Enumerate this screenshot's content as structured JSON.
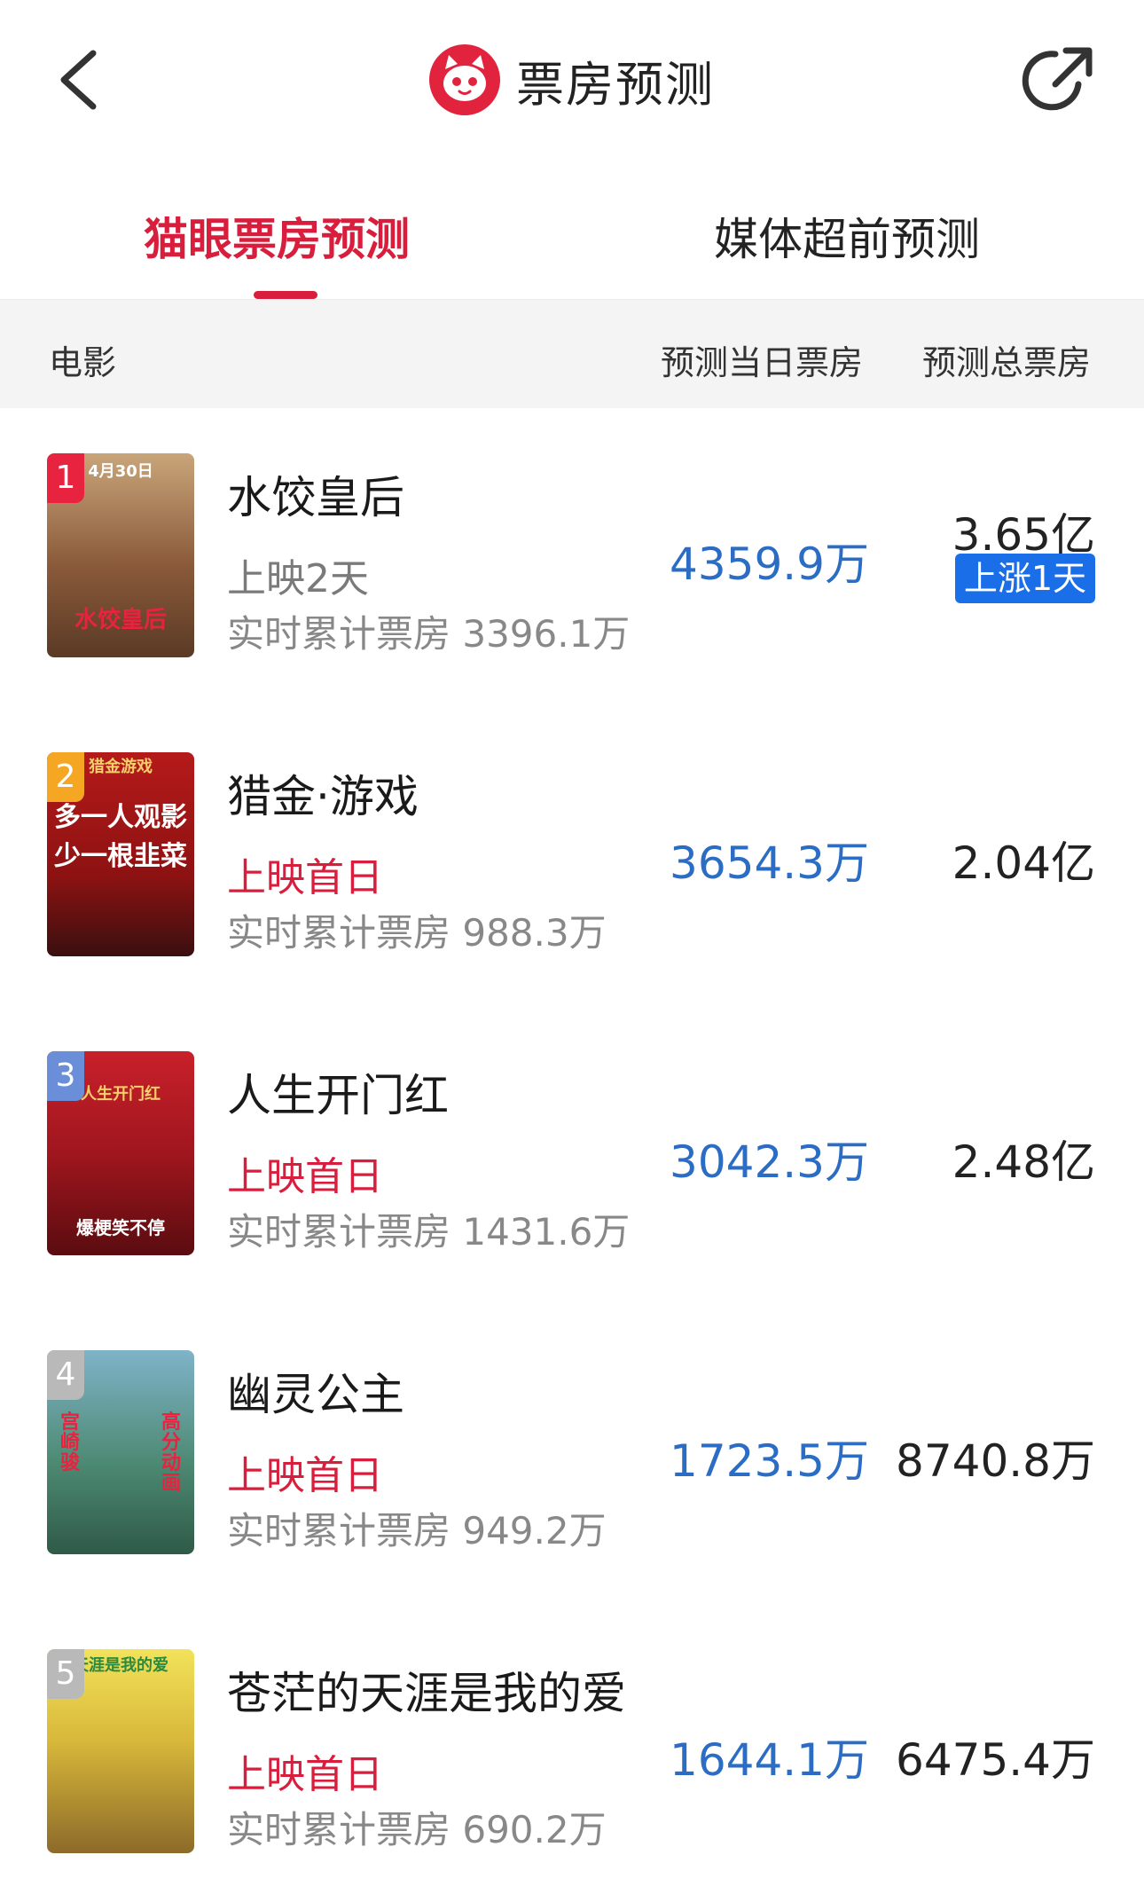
{
  "topbar": {
    "title": "票房预测",
    "back_icon": "chevron-left-icon",
    "share_icon": "share-icon",
    "logo_icon": "maoyan-cat-logo"
  },
  "tabs": [
    {
      "label": "猫眼票房预测",
      "active": true
    },
    {
      "label": "媒体超前预测",
      "active": false
    }
  ],
  "table": {
    "headers": {
      "movie": "电影",
      "day_forecast": "预测当日票房",
      "total_forecast": "预测总票房"
    },
    "rows": [
      {
        "rank": "1",
        "title": "水饺皇后",
        "status": "上映2天",
        "cumulative": "实时累计票房 3396.1万",
        "day_forecast": "4359.9万",
        "total_forecast": "3.65亿",
        "trend": "上涨1天",
        "poster_lines": [
          "4月30日",
          "水饺皇后"
        ]
      },
      {
        "rank": "2",
        "title": "猎金·游戏",
        "status": "上映首日",
        "cumulative": "实时累计票房 988.3万",
        "day_forecast": "3654.3万",
        "total_forecast": "2.04亿",
        "poster_lines": [
          "猎金游戏",
          "多一人观影",
          "少一根韭菜"
        ]
      },
      {
        "rank": "3",
        "title": "人生开门红",
        "status": "上映首日",
        "cumulative": "实时累计票房 1431.6万",
        "day_forecast": "3042.3万",
        "total_forecast": "2.48亿",
        "poster_lines": [
          "人生开门红",
          "爆梗笑不停"
        ]
      },
      {
        "rank": "4",
        "title": "幽灵公主",
        "status": "上映首日",
        "cumulative": "实时累计票房 949.2万",
        "day_forecast": "1723.5万",
        "total_forecast": "8740.8万",
        "poster_lines": [
          "宫崎骏",
          "高分动画"
        ]
      },
      {
        "rank": "5",
        "title": "苍茫的天涯是我的爱",
        "status": "上映首日",
        "cumulative": "实时累计票房 690.2万",
        "day_forecast": "1644.1万",
        "total_forecast": "6475.4万",
        "poster_lines": [
          "天涯是我的爱"
        ]
      }
    ]
  },
  "colors": {
    "brand_red": "#d81e3c",
    "forecast_blue": "#2b6cc4",
    "trend_badge_blue": "#1a6ee8",
    "rank_1": "#e8233f",
    "rank_2": "#f5a623",
    "rank_3": "#6a8fd8",
    "rank_other": "#b9b9b9"
  }
}
